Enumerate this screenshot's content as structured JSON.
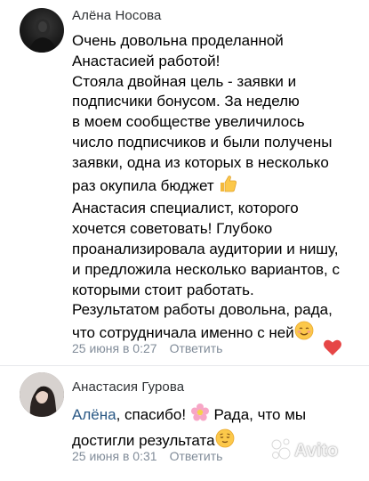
{
  "comments": [
    {
      "author": "Алёна Носова",
      "lines": [
        "Очень довольна проделанной",
        "Анастасией работой!",
        "Стояла двойная цель - заявки и",
        "подписчики бонусом. За неделю",
        "в моем сообществе увеличилось",
        "число подписчиков и были получены",
        "заявки, одна из которых в несколько",
        "раз окупила бюджет",
        "Анастасия специалист, которого",
        "хочется советовать! Глубоко",
        "проанализировала аудитории и нишу,",
        "и предложила несколько вариантов, с",
        "которыми стоит работать.",
        "Результатом работы довольна, рада,",
        "что сотрудничала именно с ней"
      ],
      "timestamp": "25 июня в 0:27",
      "reply_label": "Ответить",
      "liked": true,
      "icons": [
        "thumbs-up-emoji",
        "smiling-emoji",
        "heart-icon"
      ]
    },
    {
      "author": "Анастасия Гурова",
      "mention": "Алёна",
      "line1_rest": ", спасибо!",
      "line1_end": " Рада, что мы",
      "line2": "достигли результата",
      "timestamp": "25 июня в 0:31",
      "reply_label": "Ответить",
      "icons": [
        "flower-emoji",
        "relieved-emoji"
      ]
    }
  ],
  "watermark": "Avito",
  "colors": {
    "accent_link": "#2a5885",
    "meta": "#818c99",
    "heart": "#e64646",
    "author": "#2f3235"
  }
}
